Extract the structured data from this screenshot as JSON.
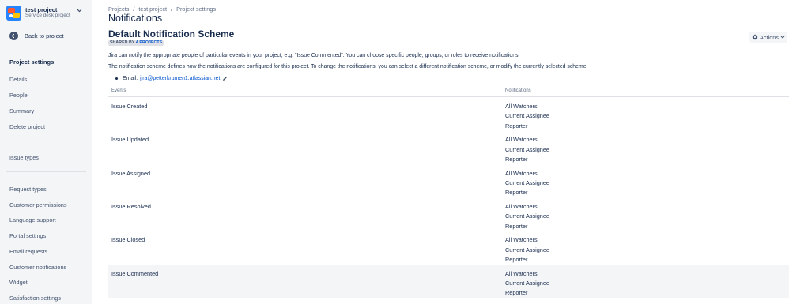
{
  "sidebar": {
    "project_name": "test project",
    "project_type": "Service desk project",
    "back_label": "Back to project",
    "heading": "Project settings",
    "group1": [
      "Details",
      "People",
      "Summary",
      "Delete project"
    ],
    "group2": [
      "Issue types"
    ],
    "group3": [
      "Request types",
      "Customer permissions",
      "Language support",
      "Portal settings",
      "Email requests",
      "Customer notifications",
      "Widget",
      "Satisfaction settings"
    ]
  },
  "breadcrumb": [
    "Projects",
    "test project",
    "Project settings"
  ],
  "page_title": "Notifications",
  "scheme": {
    "title": "Default Notification Scheme",
    "shared_prefix": "SHARED BY",
    "shared_count": "4 PROJECTS"
  },
  "actions_label": "Actions",
  "description": {
    "line1": "Jira can notify the appropriate people of particular events in your project, e.g. \"Issue Commented\". You can choose specific people, groups, or roles to receive notifications.",
    "line2": "The notification scheme defines how the notifications are configured for this project. To change the notifications, you can select a different notification scheme, or modify the currently selected scheme."
  },
  "email": {
    "label": "Email:",
    "address": "jira@petterkrumen1.atlassian.net"
  },
  "table": {
    "headers": [
      "Events",
      "Notifications"
    ],
    "rows": [
      {
        "event": "Issue Created",
        "notifications": [
          "All Watchers",
          "Current Assignee",
          "Reporter"
        ]
      },
      {
        "event": "Issue Updated",
        "notifications": [
          "All Watchers",
          "Current Assignee",
          "Reporter"
        ]
      },
      {
        "event": "Issue Assigned",
        "notifications": [
          "All Watchers",
          "Current Assignee",
          "Reporter"
        ]
      },
      {
        "event": "Issue Resolved",
        "notifications": [
          "All Watchers",
          "Current Assignee",
          "Reporter"
        ]
      },
      {
        "event": "Issue Closed",
        "notifications": [
          "All Watchers",
          "Current Assignee",
          "Reporter"
        ]
      },
      {
        "event": "Issue Commented",
        "notifications": [
          "All Watchers",
          "Current Assignee",
          "Reporter"
        ]
      }
    ]
  },
  "colors": {
    "link": "#0052cc",
    "text": "#172b4d",
    "sidebar_bg": "#f4f5f7"
  }
}
